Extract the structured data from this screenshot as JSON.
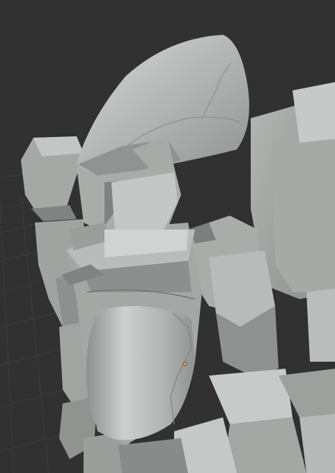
{
  "viewport": {
    "mode": "3d-viewport",
    "shading": "solid",
    "background_color": "#313131",
    "grid_line_color": "#3d3d3d",
    "model_base_color": "#a9aeab",
    "origin_point_color": "#e8a33a",
    "objects": [
      "helmet",
      "face-visor",
      "chest-plate",
      "left-shoulder-armor",
      "right-shoulder-armor",
      "lower-body-parts"
    ]
  }
}
